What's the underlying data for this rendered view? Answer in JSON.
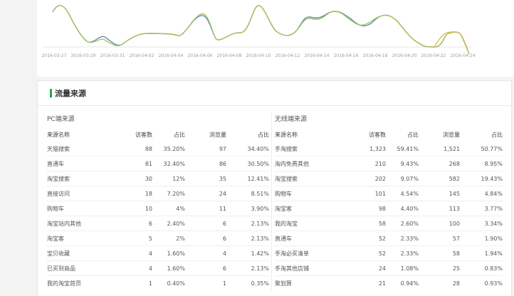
{
  "colors": {
    "accent": "#2f9e55",
    "line_green": "#a9c25b",
    "line_blue": "#5b8fb2",
    "line_orange": "#e0b15a"
  },
  "chart": {
    "dates": [
      "2016-03-27",
      "2016-03-29",
      "2016-03-31",
      "2016-04-02",
      "2016-04-04",
      "2016-04-06",
      "2016-04-08",
      "2016-04-10",
      "2016-04-12",
      "2016-04-14",
      "2016-04-16",
      "2016-04-18",
      "2016-04-20",
      "2016-04-22",
      "2016-04-24"
    ]
  },
  "traffic": {
    "title": "流量来源",
    "pc": {
      "title": "PC端来源",
      "headers": [
        "来源名称",
        "访客数",
        "占比",
        "浏览量",
        "占比"
      ],
      "rows": [
        [
          "天猫搜索",
          "88",
          "35.20%",
          "97",
          "34.40%"
        ],
        [
          "直通车",
          "81",
          "32.40%",
          "86",
          "30.50%"
        ],
        [
          "淘宝搜索",
          "30",
          "12%",
          "35",
          "12.41%"
        ],
        [
          "直接访问",
          "18",
          "7.20%",
          "24",
          "8.51%"
        ],
        [
          "购物车",
          "10",
          "4%",
          "11",
          "3.90%"
        ],
        [
          "淘宝站内其他",
          "6",
          "2.40%",
          "6",
          "2.13%"
        ],
        [
          "淘宝客",
          "5",
          "2%",
          "6",
          "2.13%"
        ],
        [
          "宝贝收藏",
          "4",
          "1.60%",
          "4",
          "1.42%"
        ],
        [
          "已买到商品",
          "4",
          "1.60%",
          "6",
          "2.13%"
        ],
        [
          "我的淘宝首页",
          "1",
          "0.40%",
          "1",
          "0.35%"
        ]
      ]
    },
    "mobile": {
      "title": "无线端来源",
      "headers": [
        "来源名称",
        "访客数",
        "占比",
        "浏览量",
        "占比"
      ],
      "rows": [
        [
          "手淘搜索",
          "1,323",
          "59.41%",
          "1,521",
          "50.77%"
        ],
        [
          "淘内免费其他",
          "210",
          "9.43%",
          "268",
          "8.95%"
        ],
        [
          "淘宝搜索",
          "202",
          "9.07%",
          "582",
          "19.43%"
        ],
        [
          "购物车",
          "101",
          "4.54%",
          "145",
          "4.84%"
        ],
        [
          "淘宝客",
          "98",
          "4.40%",
          "113",
          "3.77%"
        ],
        [
          "我的淘宝",
          "58",
          "2.60%",
          "100",
          "3.34%"
        ],
        [
          "直通车",
          "52",
          "2.33%",
          "57",
          "1.90%"
        ],
        [
          "手淘必买清单",
          "52",
          "2.33%",
          "58",
          "1.94%"
        ],
        [
          "手淘其他店铺",
          "24",
          "1.08%",
          "25",
          "0.83%"
        ],
        [
          "聚划算",
          "21",
          "0.94%",
          "28",
          "0.93%"
        ]
      ]
    }
  }
}
